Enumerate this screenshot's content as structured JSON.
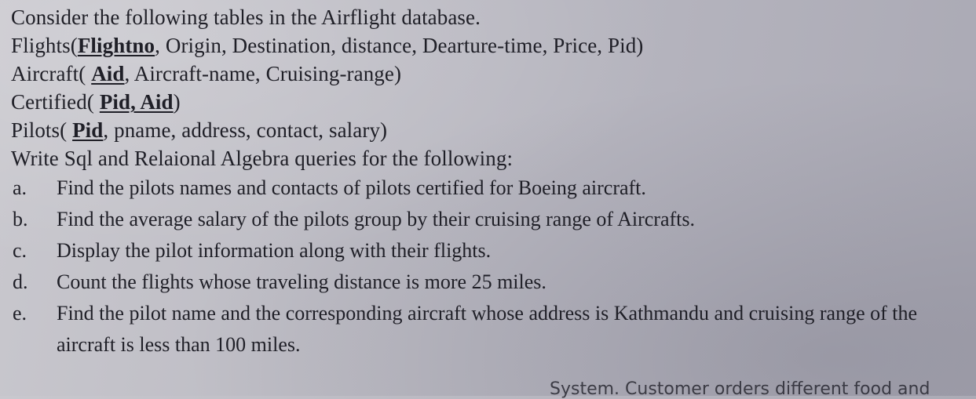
{
  "intro": "Consider the following tables in the Airflight database.",
  "tables": [
    {
      "name": "Flights(",
      "key": "Flightno",
      "rest": ", Origin, Destination, distance, Dearture-time, Price, Pid)"
    },
    {
      "name": "Aircraft( ",
      "key": "Aid",
      "rest": ", Aircraft-name, Cruising-range)"
    },
    {
      "name": "Certified( ",
      "key": "Pid, Aid",
      "rest": ")"
    },
    {
      "name": "Pilots( ",
      "key": "Pid",
      "rest": ", pname, address, contact, salary)"
    }
  ],
  "instruction": "Write Sql and Relaional Algebra queries for the following:",
  "questions": [
    {
      "letter": "a.",
      "text": "Find the pilots names and contacts of pilots certified for Boeing aircraft."
    },
    {
      "letter": "b.",
      "text": "Find the average salary of the pilots group by their cruising range of Aircrafts."
    },
    {
      "letter": "c.",
      "text": "Display the pilot information along with their flights."
    },
    {
      "letter": "d.",
      "text": "Count the flights whose traveling distance is more 25 miles."
    },
    {
      "letter": "e.",
      "text": "Find the pilot name and the corresponding aircraft whose address is Kathmandu and cruising range of the aircraft is less than 100 miles."
    }
  ],
  "cutoff_text": "System. Customer orders different food and"
}
